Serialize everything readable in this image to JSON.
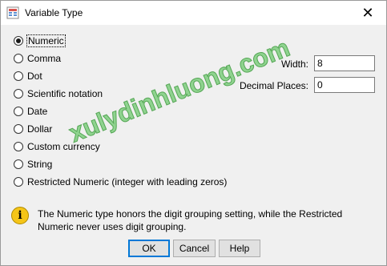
{
  "window": {
    "title": "Variable Type",
    "close_glyph": "✕"
  },
  "types": [
    {
      "label": "Numeric",
      "checked": true
    },
    {
      "label": "Comma",
      "checked": false
    },
    {
      "label": "Dot",
      "checked": false
    },
    {
      "label": "Scientific notation",
      "checked": false
    },
    {
      "label": "Date",
      "checked": false
    },
    {
      "label": "Dollar",
      "checked": false
    },
    {
      "label": "Custom currency",
      "checked": false
    },
    {
      "label": "String",
      "checked": false
    },
    {
      "label": "Restricted Numeric (integer with leading zeros)",
      "checked": false
    }
  ],
  "fields": {
    "width_label": "Width:",
    "width_value": "8",
    "decimal_label": "Decimal Places:",
    "decimal_value": "0"
  },
  "info": {
    "icon": "info-icon",
    "text": "The Numeric type honors the digit grouping setting, while the Restricted Numeric never uses digit grouping."
  },
  "buttons": {
    "ok": "OK",
    "cancel": "Cancel",
    "help": "Help"
  },
  "watermark": "xulydinhluong.com"
}
